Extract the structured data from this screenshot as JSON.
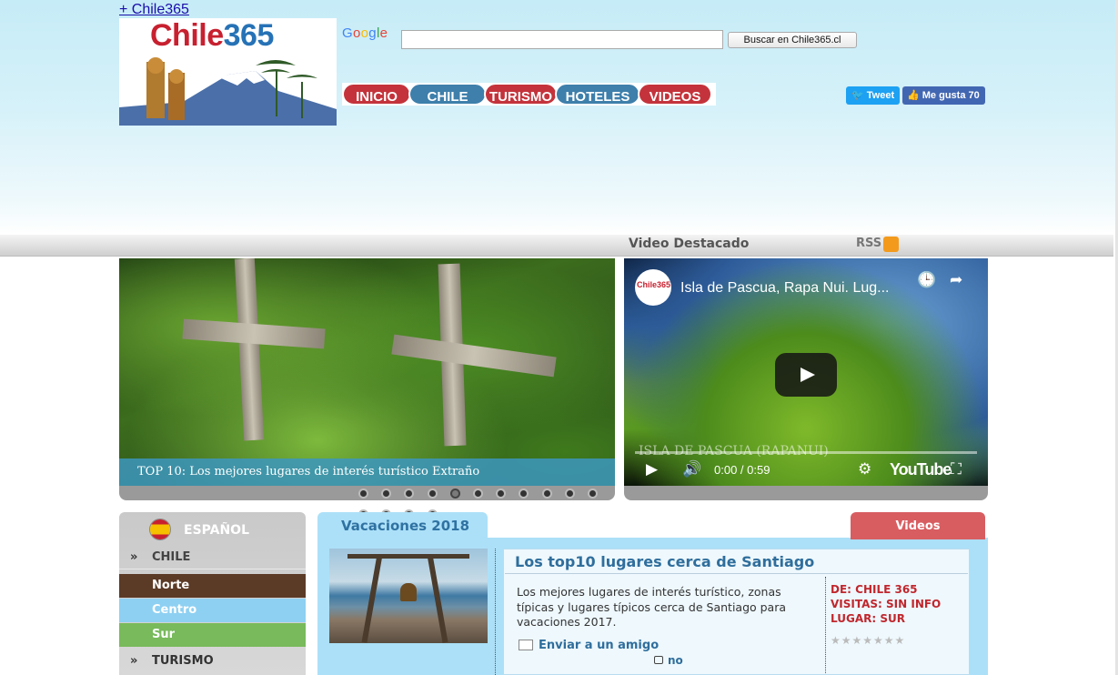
{
  "top_link": "+ Chile365",
  "logo": {
    "part_a": "Chile",
    "part_b": "365"
  },
  "search": {
    "google_label": "Google",
    "button": "Buscar en Chile365.cl",
    "value": ""
  },
  "nav": [
    "INICIO",
    "CHILE",
    "TURISMO",
    "HOTELES",
    "VIDEOS"
  ],
  "social": {
    "tweet": "Tweet",
    "like": "Me gusta 70"
  },
  "featured": {
    "title": "Video Destacado",
    "rss": "RSS"
  },
  "slider": {
    "caption": "TOP 10: Los mejores lugares de interés turístico Extraño",
    "total_dots": 11,
    "active_dot": 5
  },
  "video": {
    "title": "Isla de Pascua, Rapa Nui. Lug...",
    "logo": "Chile365",
    "overlay_text": "ISLA DE PASCUA (RAPANUI)",
    "time": "0:00 / 0:59",
    "brand": "YouTube"
  },
  "sidebar": {
    "language": "ESPAÑOL",
    "items": [
      {
        "label": "CHILE",
        "arrow": "»"
      },
      {
        "label": "Norte"
      },
      {
        "label": "Centro"
      },
      {
        "label": "Sur"
      },
      {
        "label": "TURISMO",
        "arrow": "»"
      }
    ]
  },
  "content": {
    "tab_left": "Vacaciones 2018",
    "tab_right": "Videos",
    "article": {
      "title": "Los top10 lugares cerca de Santiago",
      "description": "Los mejores lugares de interés turístico, zonas típicas y lugares típicos cerca de Santiago para vacaciones 2017.",
      "send": "Enviar a un amigo",
      "comments": "no",
      "author": "DE: CHILE 365",
      "visits": "VISITAS: SIN INFO",
      "place": "LUGAR: SUR",
      "rating_stars": 7
    }
  },
  "colors": {
    "red": "#c4333b",
    "blue": "#3e7fab",
    "sky": "#ace0f8",
    "norte": "#5b3a26",
    "centro": "#8ed0f2",
    "sur": "#78ba5c"
  }
}
